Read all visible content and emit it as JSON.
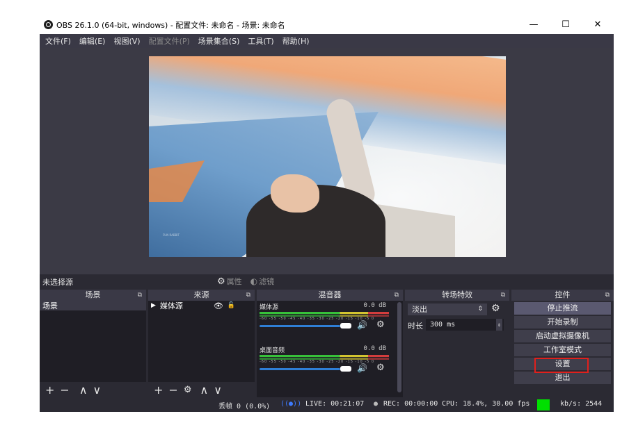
{
  "window": {
    "title": "OBS 26.1.0 (64-bit, windows) - 配置文件: 未命名 - 场景: 未命名",
    "minimize": "—",
    "maximize": "☐",
    "close": "✕"
  },
  "menu": [
    {
      "label": "文件(F)"
    },
    {
      "label": "编辑(E)"
    },
    {
      "label": "视图(V)"
    },
    {
      "label": "配置文件(P)"
    },
    {
      "label": "场景集合(S)"
    },
    {
      "label": "工具(T)"
    },
    {
      "label": "帮助(H)"
    }
  ],
  "preview": {
    "caption": "FUN RABBIT"
  },
  "source_bar": {
    "label": "未选择源",
    "properties": "属性",
    "filters": "滤镜"
  },
  "docks": {
    "scenes": {
      "title": "场景",
      "items": [
        "场景"
      ]
    },
    "sources": {
      "title": "来源",
      "items": [
        "媒体源"
      ]
    },
    "mixer": {
      "title": "混音器",
      "channels": [
        {
          "name": "媒体源",
          "db": "0.0 dB"
        },
        {
          "name": "桌面音频",
          "db": "0.0 dB"
        }
      ],
      "ticks": "-60 -55 -50 -45 -40 -35 -30 -25 -20 -15 -10 -5 0"
    },
    "transitions": {
      "title": "转场特效",
      "selected": "淡出",
      "duration_label": "时长",
      "duration_value": "300 ms"
    },
    "controls": {
      "title": "控件",
      "buttons": [
        "停止推流",
        "开始录制",
        "启动虚拟摄像机",
        "工作室模式",
        "设置",
        "退出"
      ]
    }
  },
  "status": {
    "dropped": "丢帧 0 (0.0%)",
    "live": "LIVE: 00:21:07",
    "rec": "REC: 00:00:00",
    "cpu": "CPU: 18.4%, 30.00 fps",
    "kbps": "kb/s: 2544",
    "stream_color": "#00e000"
  }
}
